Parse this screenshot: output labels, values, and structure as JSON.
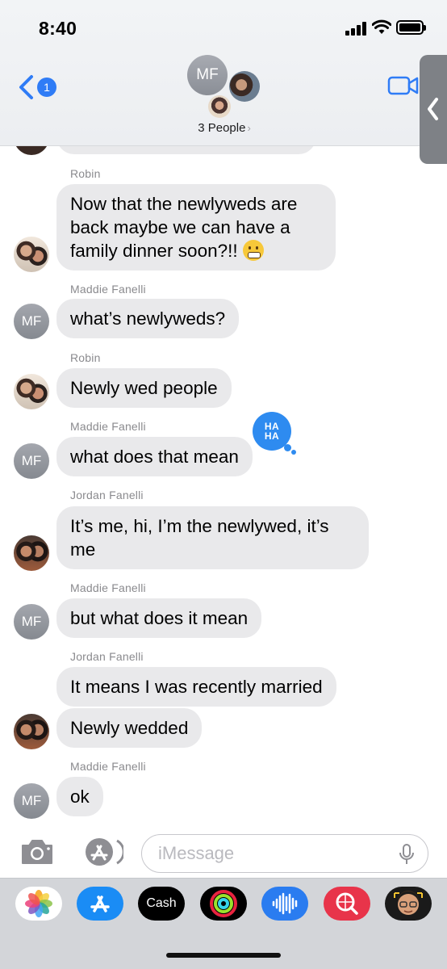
{
  "status_bar": {
    "time": "8:40"
  },
  "header": {
    "back_badge_count": "1",
    "group_avatar_initials": "MF",
    "people_label": "3 People",
    "people_chevron": "›"
  },
  "thread": {
    "messages": [
      {
        "sender": "Robin",
        "text": "Now that the newlyweds are back maybe we can have a family dinner soon?!!",
        "emoji": "grimacing-face"
      },
      {
        "sender": "Maddie Fanelli",
        "text": "what’s newlyweds?"
      },
      {
        "sender": "Robin",
        "text": "Newly wed people"
      },
      {
        "sender": "Maddie Fanelli",
        "text": "what does that mean",
        "tapback": "HA HA"
      },
      {
        "sender": "Jordan Fanelli",
        "text": "It’s me, hi, I’m the newlywed, it’s me"
      },
      {
        "sender": "Maddie Fanelli",
        "text": "but what does it mean"
      },
      {
        "sender": "Jordan Fanelli",
        "text": "It means I was recently married"
      },
      {
        "sender": "",
        "text": "Newly wedded"
      },
      {
        "sender": "Maddie Fanelli",
        "text": "ok"
      }
    ],
    "mf_initials": "MF"
  },
  "input": {
    "placeholder": "iMessage"
  },
  "app_drawer": {
    "apps": [
      "photos-icon",
      "app-store-icon",
      "apple-cash-icon",
      "fitness-icon",
      "audio-message-icon",
      "images-search-icon",
      "memoji-icon"
    ],
    "cash_label": "Cash"
  },
  "colors": {
    "accent": "#2f7cf6",
    "bubble": "#e9e9eb",
    "tapback": "#2e8bf0"
  }
}
